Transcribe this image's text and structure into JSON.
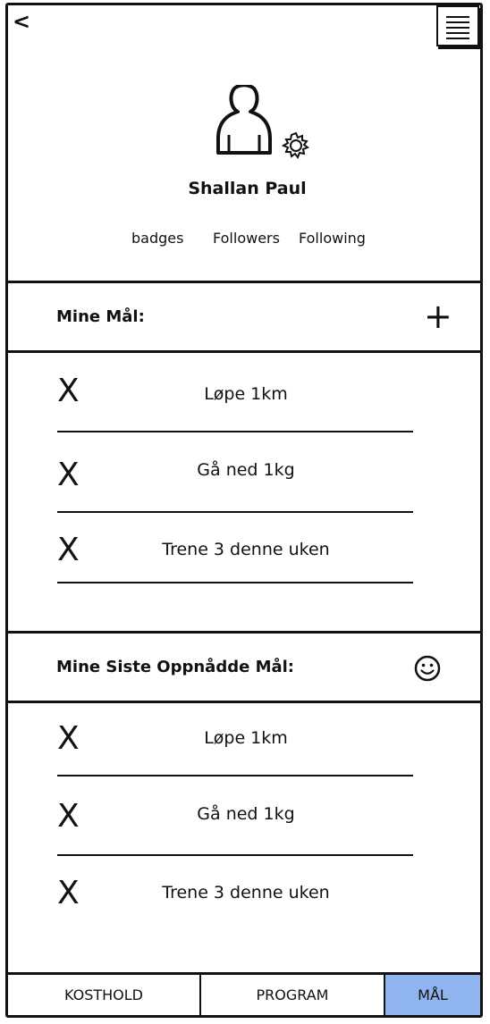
{
  "header": {
    "back_label": "<"
  },
  "profile": {
    "name": "Shallan Paul",
    "stats": [
      "badges",
      "Followers",
      "Following"
    ]
  },
  "goals": {
    "title": "Mine Mål:",
    "add_label": "+",
    "items": [
      {
        "mark": "X",
        "text": "Løpe 1km"
      },
      {
        "mark": "X",
        "text": "Gå ned 1kg"
      },
      {
        "mark": "X",
        "text": "Trene 3 denne uken"
      }
    ]
  },
  "achieved": {
    "title": "Mine Siste Oppnådde Mål:",
    "items": [
      {
        "mark": "X",
        "text": "Løpe 1km"
      },
      {
        "mark": "X",
        "text": "Gå ned 1kg"
      },
      {
        "mark": "X",
        "text": "Trene 3 denne uken"
      }
    ]
  },
  "tabs": [
    {
      "label": "KOSTHOLD"
    },
    {
      "label": "PROGRAM"
    },
    {
      "label": "MÅL"
    }
  ],
  "colors": {
    "active_tab": "#8fb4ef",
    "ink": "#111111"
  }
}
